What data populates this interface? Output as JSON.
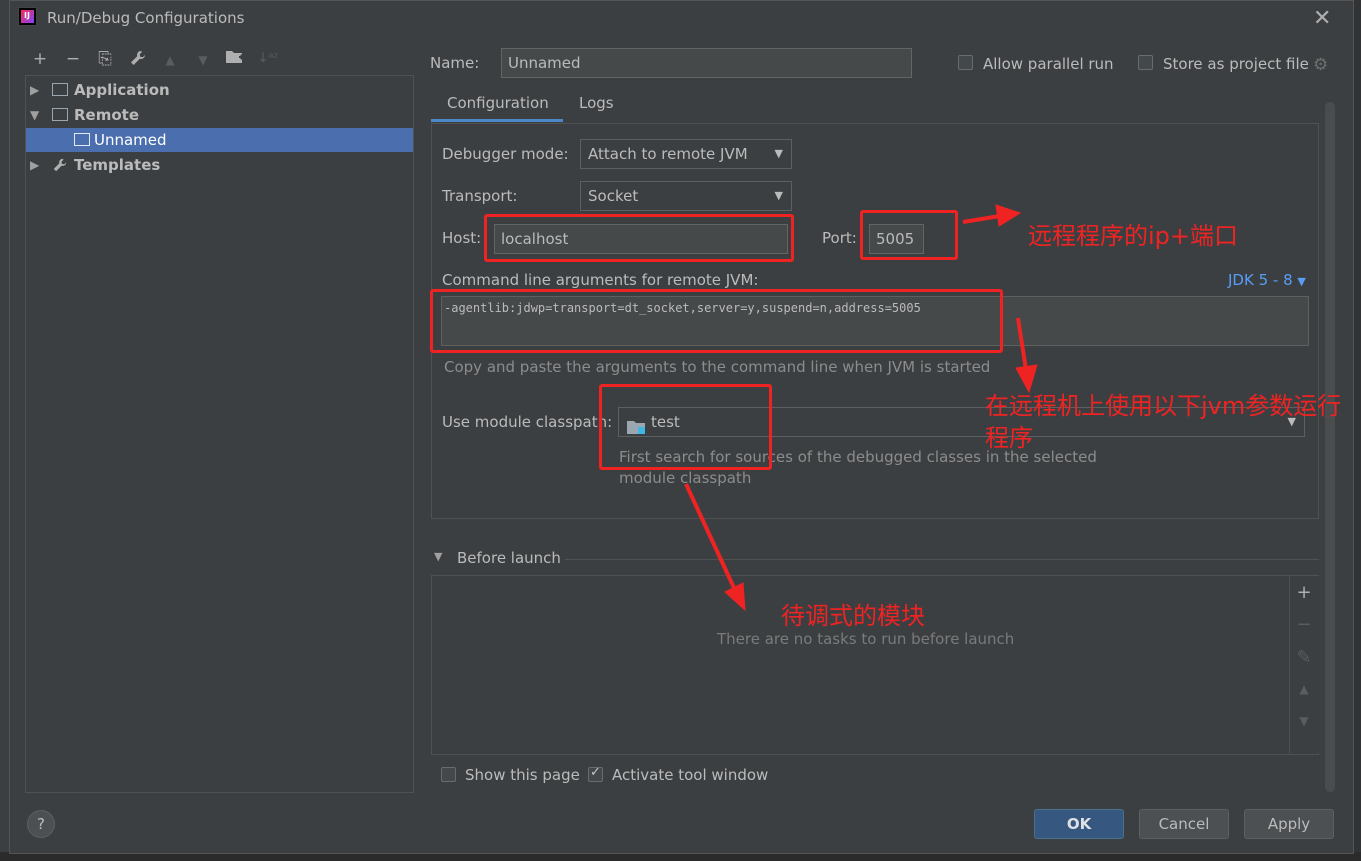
{
  "window": {
    "title": "Run/Debug Configurations",
    "logo_text": "IJ"
  },
  "toolbar": {
    "add": "+",
    "remove": "−",
    "copy": "⎘",
    "settings": "🔧",
    "up": "▲",
    "down": "▼",
    "folder": "📁",
    "sort": "↓ᵃᶻ"
  },
  "tree": {
    "application": "Application",
    "remote": "Remote",
    "unnamed": "Unnamed",
    "templates": "Templates"
  },
  "header": {
    "name_label": "Name:",
    "name_value": "Unnamed",
    "allow_parallel": "Allow parallel run",
    "store_project": "Store as project file"
  },
  "tabs": {
    "configuration": "Configuration",
    "logs": "Logs"
  },
  "config": {
    "debugger_mode_label": "Debugger mode:",
    "debugger_mode_value": "Attach to remote JVM",
    "transport_label": "Transport:",
    "transport_value": "Socket",
    "host_label": "Host:",
    "host_value": "localhost",
    "port_label": "Port:",
    "port_value": "5005",
    "cmd_label": "Command line arguments for remote JVM:",
    "jdk_link": "JDK 5 - 8",
    "cmd_value": "-agentlib:jdwp=transport=dt_socket,server=y,suspend=n,address=5005",
    "cmd_hint": "Copy and paste the arguments to the command line when JVM is started",
    "module_label": "Use module classpath:",
    "module_value": "test",
    "module_hint_1": "First search for sources of the debugged classes in the selected",
    "module_hint_2": "module classpath"
  },
  "before_launch": {
    "title": "Before launch",
    "empty": "There are no tasks to run before launch",
    "tools": {
      "add": "+",
      "remove": "−",
      "edit": "✎",
      "up": "▲",
      "down": "▼"
    }
  },
  "footer": {
    "show_page": "Show this page",
    "activate_tool": "Activate tool window",
    "ok": "OK",
    "cancel": "Cancel",
    "apply": "Apply",
    "help": "?"
  },
  "annotations": {
    "host_port": "远程程序的ip+端口",
    "jvm_args_1": "在远程机上使用以下jvm参数运行",
    "jvm_args_2": "程序",
    "module": "待调式的模块"
  },
  "colors": {
    "accent": "#4b6eaf",
    "annotation": "#f02323",
    "link": "#589df6",
    "ok_button": "#365880"
  }
}
